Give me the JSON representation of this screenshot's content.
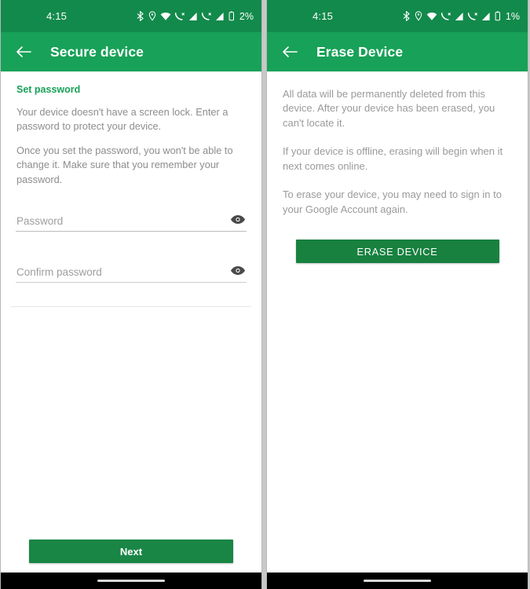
{
  "screens": [
    {
      "id": "secure-device",
      "status_bar": {
        "clock": "4:15",
        "battery_percent": "2%",
        "icons": [
          "bluetooth-icon",
          "location-icon",
          "wifi-icon",
          "cellular-call-icon",
          "signal-bars-icon",
          "cellular-call-icon",
          "signal-bars-icon",
          "battery-icon"
        ]
      },
      "app_bar": {
        "back_icon": "back-arrow-icon",
        "title": "Secure device"
      },
      "heading": "Set password",
      "paragraphs": [
        "Your device doesn't have a screen lock. Enter a password to protect your device.",
        "Once you set the password, you won't be able to change it. Make sure that you remember your password."
      ],
      "fields": [
        {
          "name": "password",
          "placeholder": "Password",
          "value": "",
          "toggle_icon": "eye-icon"
        },
        {
          "name": "confirm-password",
          "placeholder": "Confirm password",
          "value": "",
          "toggle_icon": "eye-icon"
        }
      ],
      "primary_button": "Next"
    },
    {
      "id": "erase-device",
      "status_bar": {
        "clock": "4:15",
        "battery_percent": "1%",
        "icons": [
          "bluetooth-icon",
          "location-icon",
          "wifi-icon",
          "cellular-call-icon",
          "signal-bars-icon",
          "cellular-call-icon",
          "signal-bars-icon",
          "battery-icon"
        ]
      },
      "app_bar": {
        "back_icon": "back-arrow-icon",
        "title": "Erase Device"
      },
      "paragraphs": [
        "All data will be permanently deleted from this device. After your device has been erased, you can't locate it.",
        "If your device is offline, erasing will begin when it next comes online.",
        "To erase your device, you may need to sign in to your Google Account again."
      ],
      "primary_button": "ERASE DEVICE"
    }
  ],
  "colors": {
    "status_bar_green": "#128a4b",
    "app_bar_green": "#18a158",
    "button_green": "#18813f",
    "heading_green": "#18a158",
    "body_text_gray": "#8d8d8d"
  }
}
